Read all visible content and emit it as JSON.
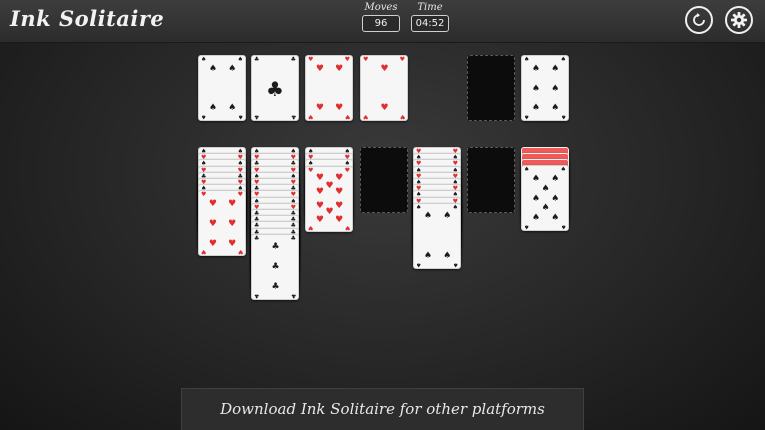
{
  "header": {
    "title": "Ink Solitaire",
    "moves_label": "Moves",
    "moves_value": "96",
    "time_label": "Time",
    "time_value": "04:52",
    "restart_icon": "restart-icon",
    "settings_icon": "gear-icon"
  },
  "colors": {
    "red": "#e12e2e",
    "back": "#ef5b5b",
    "card": "#f6f6f6"
  },
  "suit_glyphs": {
    "hearts": "♥",
    "clubs": "♣",
    "spades": "♠",
    "diamonds": "♦"
  },
  "foundations": [
    {
      "suit": "spades",
      "rank": "4"
    },
    {
      "suit": "clubs",
      "rank": "A"
    },
    {
      "suit": "hearts",
      "rank": "4"
    },
    {
      "suit": "hearts",
      "rank": "2"
    }
  ],
  "waste": {
    "empty": true
  },
  "stock": {
    "suit": "spades",
    "rank": "6"
  },
  "tableau": [
    {
      "face_up": [
        {
          "suit": "spades",
          "rank": "K"
        },
        {
          "suit": "hearts",
          "rank": "Q"
        },
        {
          "suit": "spades",
          "rank": "J"
        },
        {
          "suit": "hearts",
          "rank": "10"
        },
        {
          "suit": "clubs",
          "rank": "9"
        },
        {
          "suit": "hearts",
          "rank": "8"
        },
        {
          "suit": "spades",
          "rank": "7"
        },
        {
          "suit": "hearts",
          "rank": "6"
        }
      ]
    },
    {
      "face_up": [
        {
          "suit": "spades",
          "rank": "K"
        },
        {
          "suit": "hearts",
          "rank": "Q"
        },
        {
          "suit": "clubs",
          "rank": "J"
        },
        {
          "suit": "hearts",
          "rank": "10"
        },
        {
          "suit": "spades",
          "rank": "9"
        },
        {
          "suit": "hearts",
          "rank": "8"
        },
        {
          "suit": "clubs",
          "rank": "7"
        },
        {
          "suit": "hearts",
          "rank": "6"
        },
        {
          "suit": "spades",
          "rank": "5"
        },
        {
          "suit": "hearts",
          "rank": "4"
        },
        {
          "suit": "clubs",
          "rank": "3"
        },
        {
          "suit": "clubs",
          "rank": "3"
        },
        {
          "suit": "clubs",
          "rank": "3"
        },
        {
          "suit": "clubs",
          "rank": "3"
        },
        {
          "suit": "clubs",
          "rank": "3"
        }
      ]
    },
    {
      "face_up": [
        {
          "suit": "spades",
          "rank": "K"
        },
        {
          "suit": "hearts",
          "rank": "Q"
        },
        {
          "suit": "spades",
          "rank": "J"
        },
        {
          "suit": "hearts",
          "rank": "10"
        }
      ]
    },
    {
      "face_up": []
    },
    {
      "face_up": [
        {
          "suit": "hearts",
          "rank": "K"
        },
        {
          "suit": "spades",
          "rank": "Q"
        },
        {
          "suit": "hearts",
          "rank": "J"
        },
        {
          "suit": "spades",
          "rank": "10"
        },
        {
          "suit": "hearts",
          "rank": "9"
        },
        {
          "suit": "spades",
          "rank": "8"
        },
        {
          "suit": "hearts",
          "rank": "7"
        },
        {
          "suit": "spades",
          "rank": "6"
        },
        {
          "suit": "hearts",
          "rank": "5"
        },
        {
          "suit": "spades",
          "rank": "4"
        }
      ]
    },
    {
      "face_up": []
    },
    {
      "face_down": 3,
      "face_up": [
        {
          "suit": "spades",
          "rank": "8"
        }
      ]
    }
  ],
  "banner": {
    "text": "Download Ink Solitaire for other platforms"
  }
}
